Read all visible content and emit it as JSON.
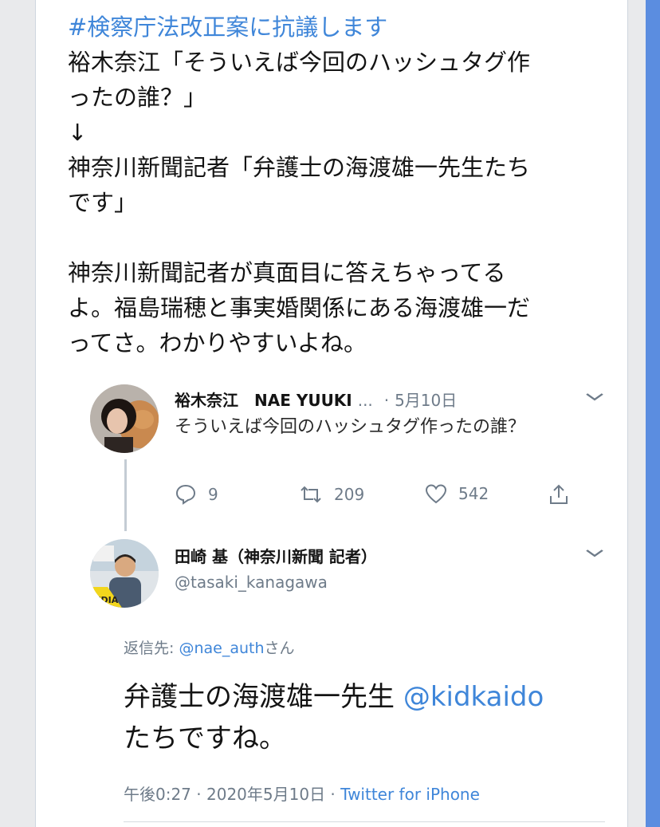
{
  "tweet": {
    "hashtag": "#検察庁法改正案に抗議します",
    "lines": [
      "裕木奈江「そういえば今回のハッシュタグ作",
      "ったの誰？」",
      "↓",
      "神奈川新聞記者「弁護士の海渡雄一先生たち",
      "です」",
      "",
      "神奈川新聞記者が真面目に答えちゃってる",
      "よ。福島瑞穂と事実婚関係にある海渡雄一だ",
      "ってさ。わかりやすいよね。"
    ]
  },
  "quoted_tweet": {
    "display_name": "裕木奈江　NAE YUUKI",
    "ellipsis": "...",
    "separator": "·",
    "date": "5月10日",
    "text": "そういえば今回のハッシュタグ作ったの誰？",
    "reply_count": "9",
    "retweet_count": "209",
    "like_count": "542"
  },
  "reply_tweet": {
    "display_name": "田崎 基（神奈川新聞 記者）",
    "handle": "@tasaki_kanagawa",
    "reply_to_label": "返信先: ",
    "reply_to_handle": "@nae_auth",
    "reply_to_suffix": "さん",
    "text_before": "弁護士の海渡雄一先生 ",
    "mention": "@kidkaido",
    "text_after": "たちですね。",
    "time": "午後0:27",
    "meta_sep": " · ",
    "date": "2020年5月10日",
    "source": "Twitter for iPhone"
  },
  "colors": {
    "accent": "#3f86d9",
    "muted": "#6e7b89",
    "edge": "#5b8de0"
  }
}
